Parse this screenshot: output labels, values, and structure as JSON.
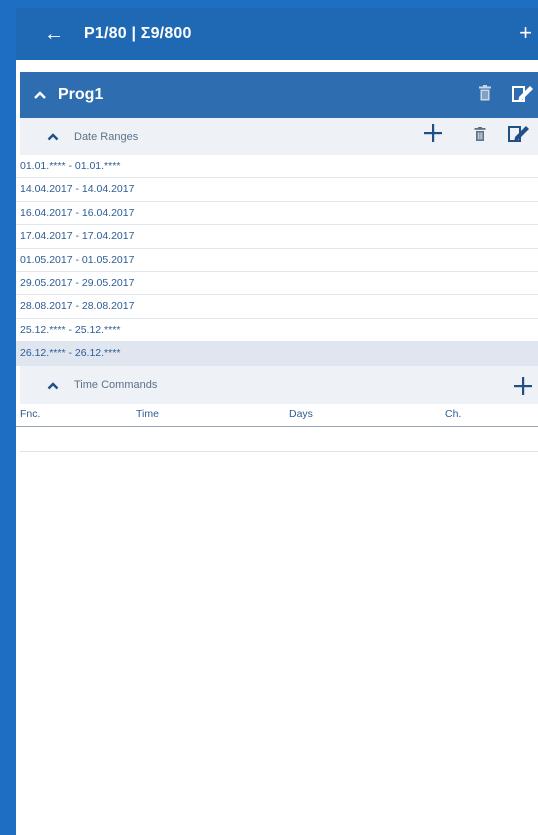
{
  "appbar": {
    "title": "P1/80 | Σ9/800",
    "back_icon": "arrow-left-icon",
    "add_icon": "plus-icon"
  },
  "program": {
    "name": "Prog1"
  },
  "date_ranges": {
    "label": "Date Ranges",
    "items": [
      "01.01.**** - 01.01.****",
      "14.04.2017 - 14.04.2017",
      "16.04.2017 - 16.04.2017",
      "17.04.2017 - 17.04.2017",
      "01.05.2017 - 01.05.2017",
      "29.05.2017 - 29.05.2017",
      "28.08.2017 - 28.08.2017",
      "25.12.**** - 25.12.****",
      "26.12.**** - 26.12.****"
    ],
    "selected_index": 8
  },
  "time_commands": {
    "label": "Time Commands",
    "columns": [
      "Fnc.",
      "Time",
      "Days",
      "Ch."
    ]
  },
  "colors": {
    "frame_bg": "#1e6fc4",
    "appbar": "#1f68b3",
    "program_header": "#2e6db0",
    "section_bg": "#eef1f6",
    "text": "#2d5c93"
  }
}
